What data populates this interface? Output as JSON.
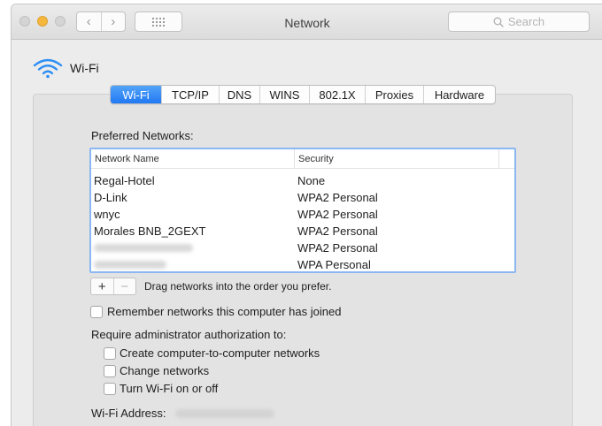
{
  "window": {
    "title": "Network"
  },
  "toolbar": {
    "back_icon": "chevron-left",
    "forward_icon": "chevron-right",
    "grid_icon": "grid",
    "back_glyph": "‹",
    "forward_glyph": "›",
    "search_placeholder": "Search"
  },
  "service": {
    "name": "Wi-Fi",
    "icon": "wifi-icon"
  },
  "tabs": [
    {
      "label": "Wi-Fi",
      "active": true
    },
    {
      "label": "TCP/IP",
      "active": false
    },
    {
      "label": "DNS",
      "active": false
    },
    {
      "label": "WINS",
      "active": false
    },
    {
      "label": "802.1X",
      "active": false
    },
    {
      "label": "Proxies",
      "active": false
    },
    {
      "label": "Hardware",
      "active": false
    }
  ],
  "preferred": {
    "heading": "Preferred Networks:",
    "columns": [
      "Network Name",
      "Security"
    ],
    "rows": [
      {
        "name": "Regal-Hotel",
        "security": "None"
      },
      {
        "name": "D-Link",
        "security": "WPA2 Personal"
      },
      {
        "name": "wnyc",
        "security": "WPA2 Personal"
      },
      {
        "name": "Morales BNB_2GEXT",
        "security": "WPA2 Personal"
      },
      {
        "name": "",
        "security": "WPA2 Personal",
        "name_obscured": true
      },
      {
        "name": "",
        "security": "WPA Personal",
        "name_obscured": true
      }
    ]
  },
  "controls": {
    "add_label": "+",
    "remove_label": "−",
    "drag_hint": "Drag networks into the order you prefer."
  },
  "options": {
    "remember_label": "Remember networks this computer has joined",
    "remember_checked": false,
    "require_heading": "Require administrator authorization to:",
    "require_items": [
      {
        "label": "Create computer-to-computer networks",
        "checked": false
      },
      {
        "label": "Change networks",
        "checked": false
      },
      {
        "label": "Turn Wi-Fi on or off",
        "checked": false
      }
    ]
  },
  "address": {
    "label": "Wi-Fi Address:",
    "value_obscured": true
  },
  "colors": {
    "accent": "#2179f3",
    "selection_border": "#8bb8f2",
    "minimize": "#f5b83d"
  }
}
